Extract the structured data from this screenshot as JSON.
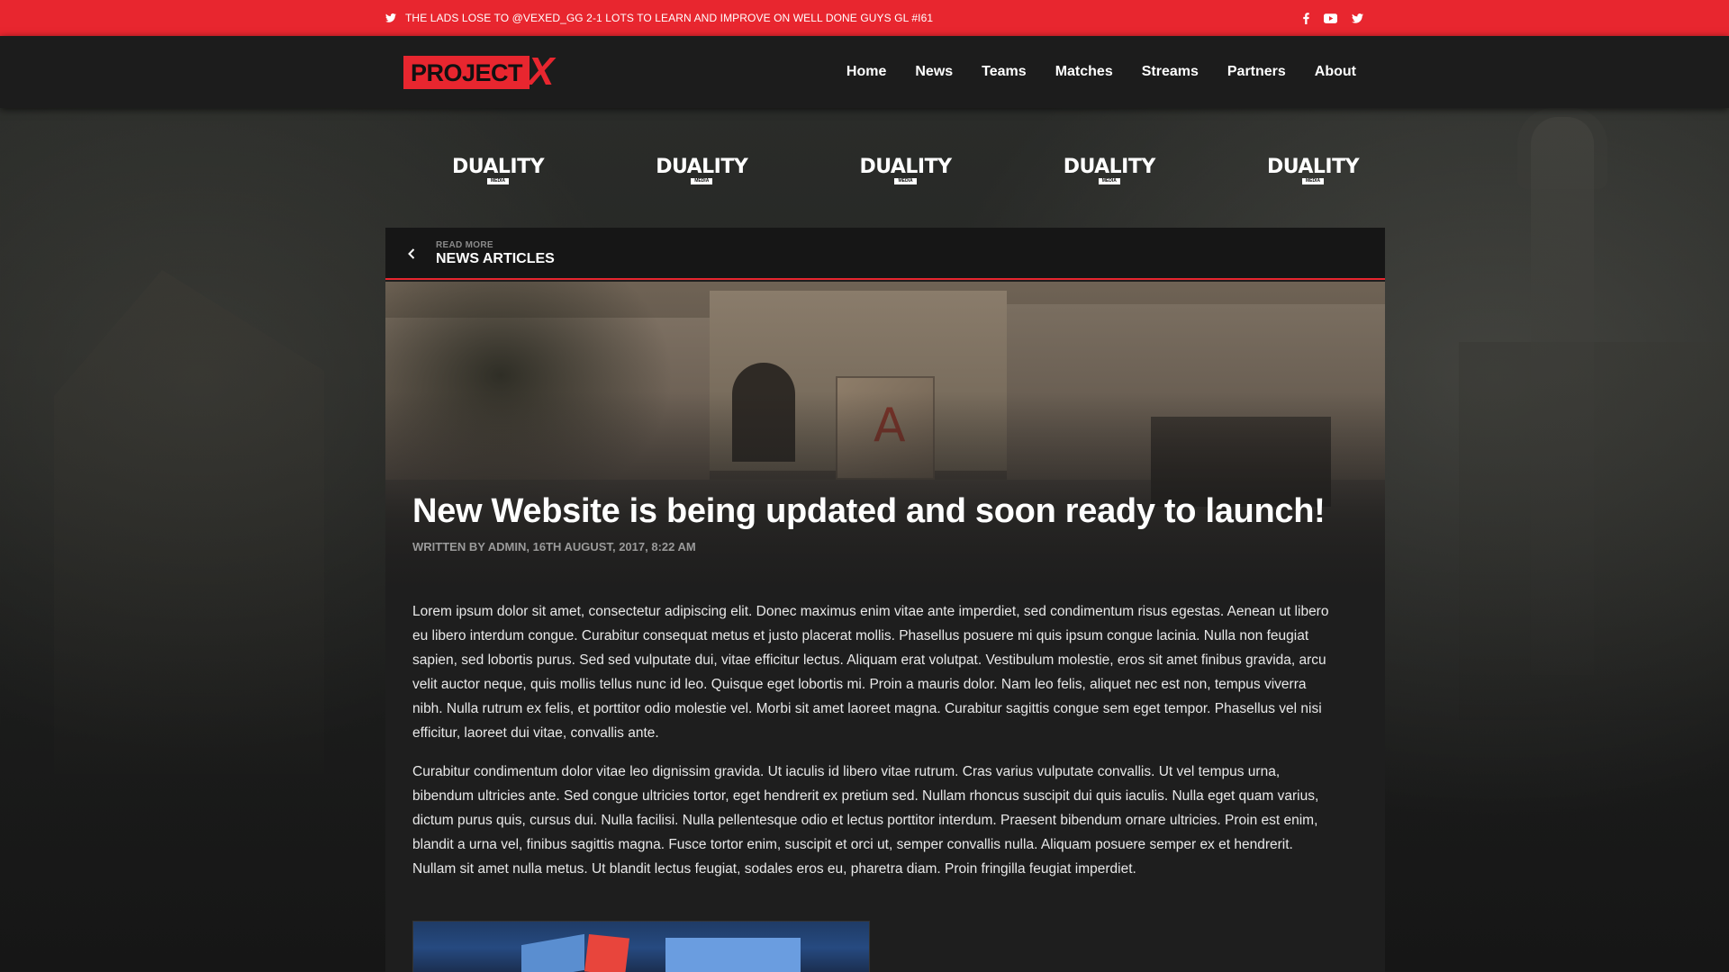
{
  "topbar": {
    "tweet_text": "THE LADS LOSE TO @VEXED_GG 2-1 LOTS TO LEARN AND IMPROVE ON WELL DONE GUYS GL #I61",
    "tweet_icon": "twitter-icon",
    "social_icons": [
      "facebook-icon",
      "youtube-icon",
      "twitter-icon"
    ]
  },
  "header": {
    "logo_text": "PROJECT",
    "logo_mark": "X",
    "nav": [
      "Home",
      "News",
      "Teams",
      "Matches",
      "Streams",
      "Partners",
      "About"
    ]
  },
  "sponsors": [
    {
      "name": "DUALITY",
      "sub": "MEDIA"
    },
    {
      "name": "DUALITY",
      "sub": "MEDIA"
    },
    {
      "name": "DUALITY",
      "sub": "MEDIA"
    },
    {
      "name": "DUALITY",
      "sub": "MEDIA"
    },
    {
      "name": "DUALITY",
      "sub": "MEDIA"
    }
  ],
  "article": {
    "back_label_small": "READ MORE",
    "back_label": "NEWS ARTICLES",
    "title": "New Website is being updated and soon ready to launch!",
    "meta": "WRITTEN BY ADMIN, 16TH AUGUST, 2017, 8:22 AM",
    "paragraphs": [
      "Lorem ipsum dolor sit amet, consectetur adipiscing elit. Donec maximus enim vitae ante imperdiet, sed condimentum risus egestas. Aenean ut libero eu libero interdum congue. Curabitur consequat metus et justo placerat mollis. Phasellus posuere mi quis ipsum congue lacinia. Nulla non feugiat sapien, sed lobortis purus. Sed sed vulputate dui, vitae efficitur lectus. Aliquam erat volutpat. Vestibulum molestie, eros sit amet finibus gravida, arcu velit auctor neque, quis mollis tellus nunc id leo. Quisque eget lobortis mi. Proin a mauris dolor. Nam leo felis, aliquet nec est non, tempus viverra nibh. Nulla rutrum ex felis, et porttitor odio molestie vel. Morbi sit amet laoreet magna. Curabitur sagittis congue sem eget tempor. Phasellus vel nisi efficitur, laoreet dui vitae, convallis ante.",
      "Curabitur condimentum dolor vitae leo dignissim gravida. Ut iaculis id libero vitae rutrum. Cras varius vulputate convallis. Ut vel tempus urna, bibendum ultricies ante. Sed congue ultricies tortor, eget hendrerit ex pretium sed. Nullam rhoncus suscipit dui quis iaculis. Nulla eget quam varius, dictum purus quis, cursus dui. Nulla facilisi. Nulla pellentesque odio et lectus porttitor interdum. Praesent bibendum ornare ultricies. Proin est enim, blandit a urna vel, finibus sagittis magna. Fusce tortor enim, suscipit et orci ut, semper convallis nulla. Aliquam posuere semper ex et hendrerit. Nullam sit amet nulla metus. Ut blandit lectus feugiat, sodales eros eu, pharetra diam. Proin fringilla feugiat imperdiet."
    ]
  },
  "colors": {
    "accent": "#e8262f",
    "header_bg": "#1c1c1c",
    "panel_bg": "#1e1e1e"
  }
}
